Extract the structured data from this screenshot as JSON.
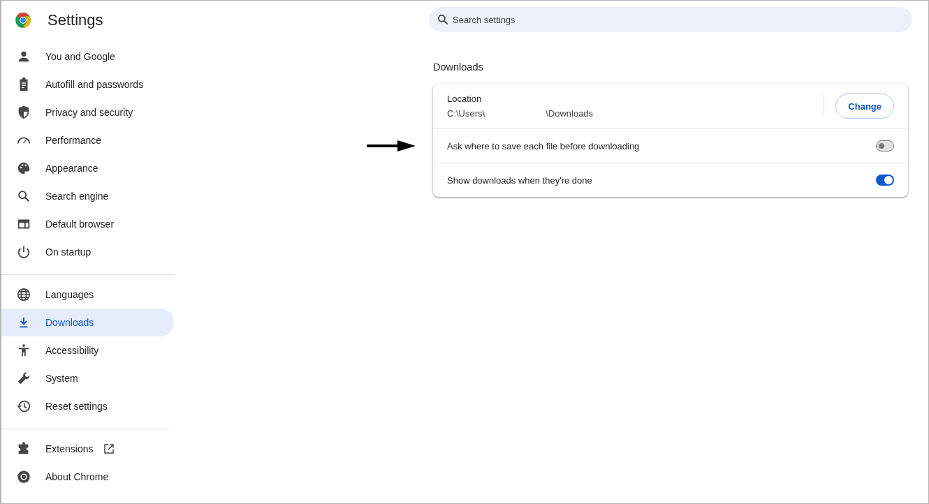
{
  "header": {
    "title": "Settings"
  },
  "search": {
    "placeholder": "Search settings"
  },
  "sidebar": {
    "sections": [
      {
        "items": [
          {
            "label": "You and Google",
            "selected": false,
            "external": false
          },
          {
            "label": "Autofill and passwords",
            "selected": false,
            "external": false
          },
          {
            "label": "Privacy and security",
            "selected": false,
            "external": false
          },
          {
            "label": "Performance",
            "selected": false,
            "external": false
          },
          {
            "label": "Appearance",
            "selected": false,
            "external": false
          },
          {
            "label": "Search engine",
            "selected": false,
            "external": false
          },
          {
            "label": "Default browser",
            "selected": false,
            "external": false
          },
          {
            "label": "On startup",
            "selected": false,
            "external": false
          }
        ]
      },
      {
        "items": [
          {
            "label": "Languages",
            "selected": false,
            "external": false
          },
          {
            "label": "Downloads",
            "selected": true,
            "external": false
          },
          {
            "label": "Accessibility",
            "selected": false,
            "external": false
          },
          {
            "label": "System",
            "selected": false,
            "external": false
          },
          {
            "label": "Reset settings",
            "selected": false,
            "external": false
          }
        ]
      },
      {
        "items": [
          {
            "label": "Extensions",
            "selected": false,
            "external": true
          },
          {
            "label": "About Chrome",
            "selected": false,
            "external": false
          }
        ]
      }
    ]
  },
  "section": {
    "heading": "Downloads",
    "location": {
      "label": "Location",
      "path_start": "C:\\Users\\",
      "path_end": "\\Downloads",
      "button": "Change"
    },
    "toggles": [
      {
        "label": "Ask where to save each file before downloading",
        "on": false,
        "pointed": true
      },
      {
        "label": "Show downloads when they're done",
        "on": true,
        "pointed": false
      }
    ]
  }
}
